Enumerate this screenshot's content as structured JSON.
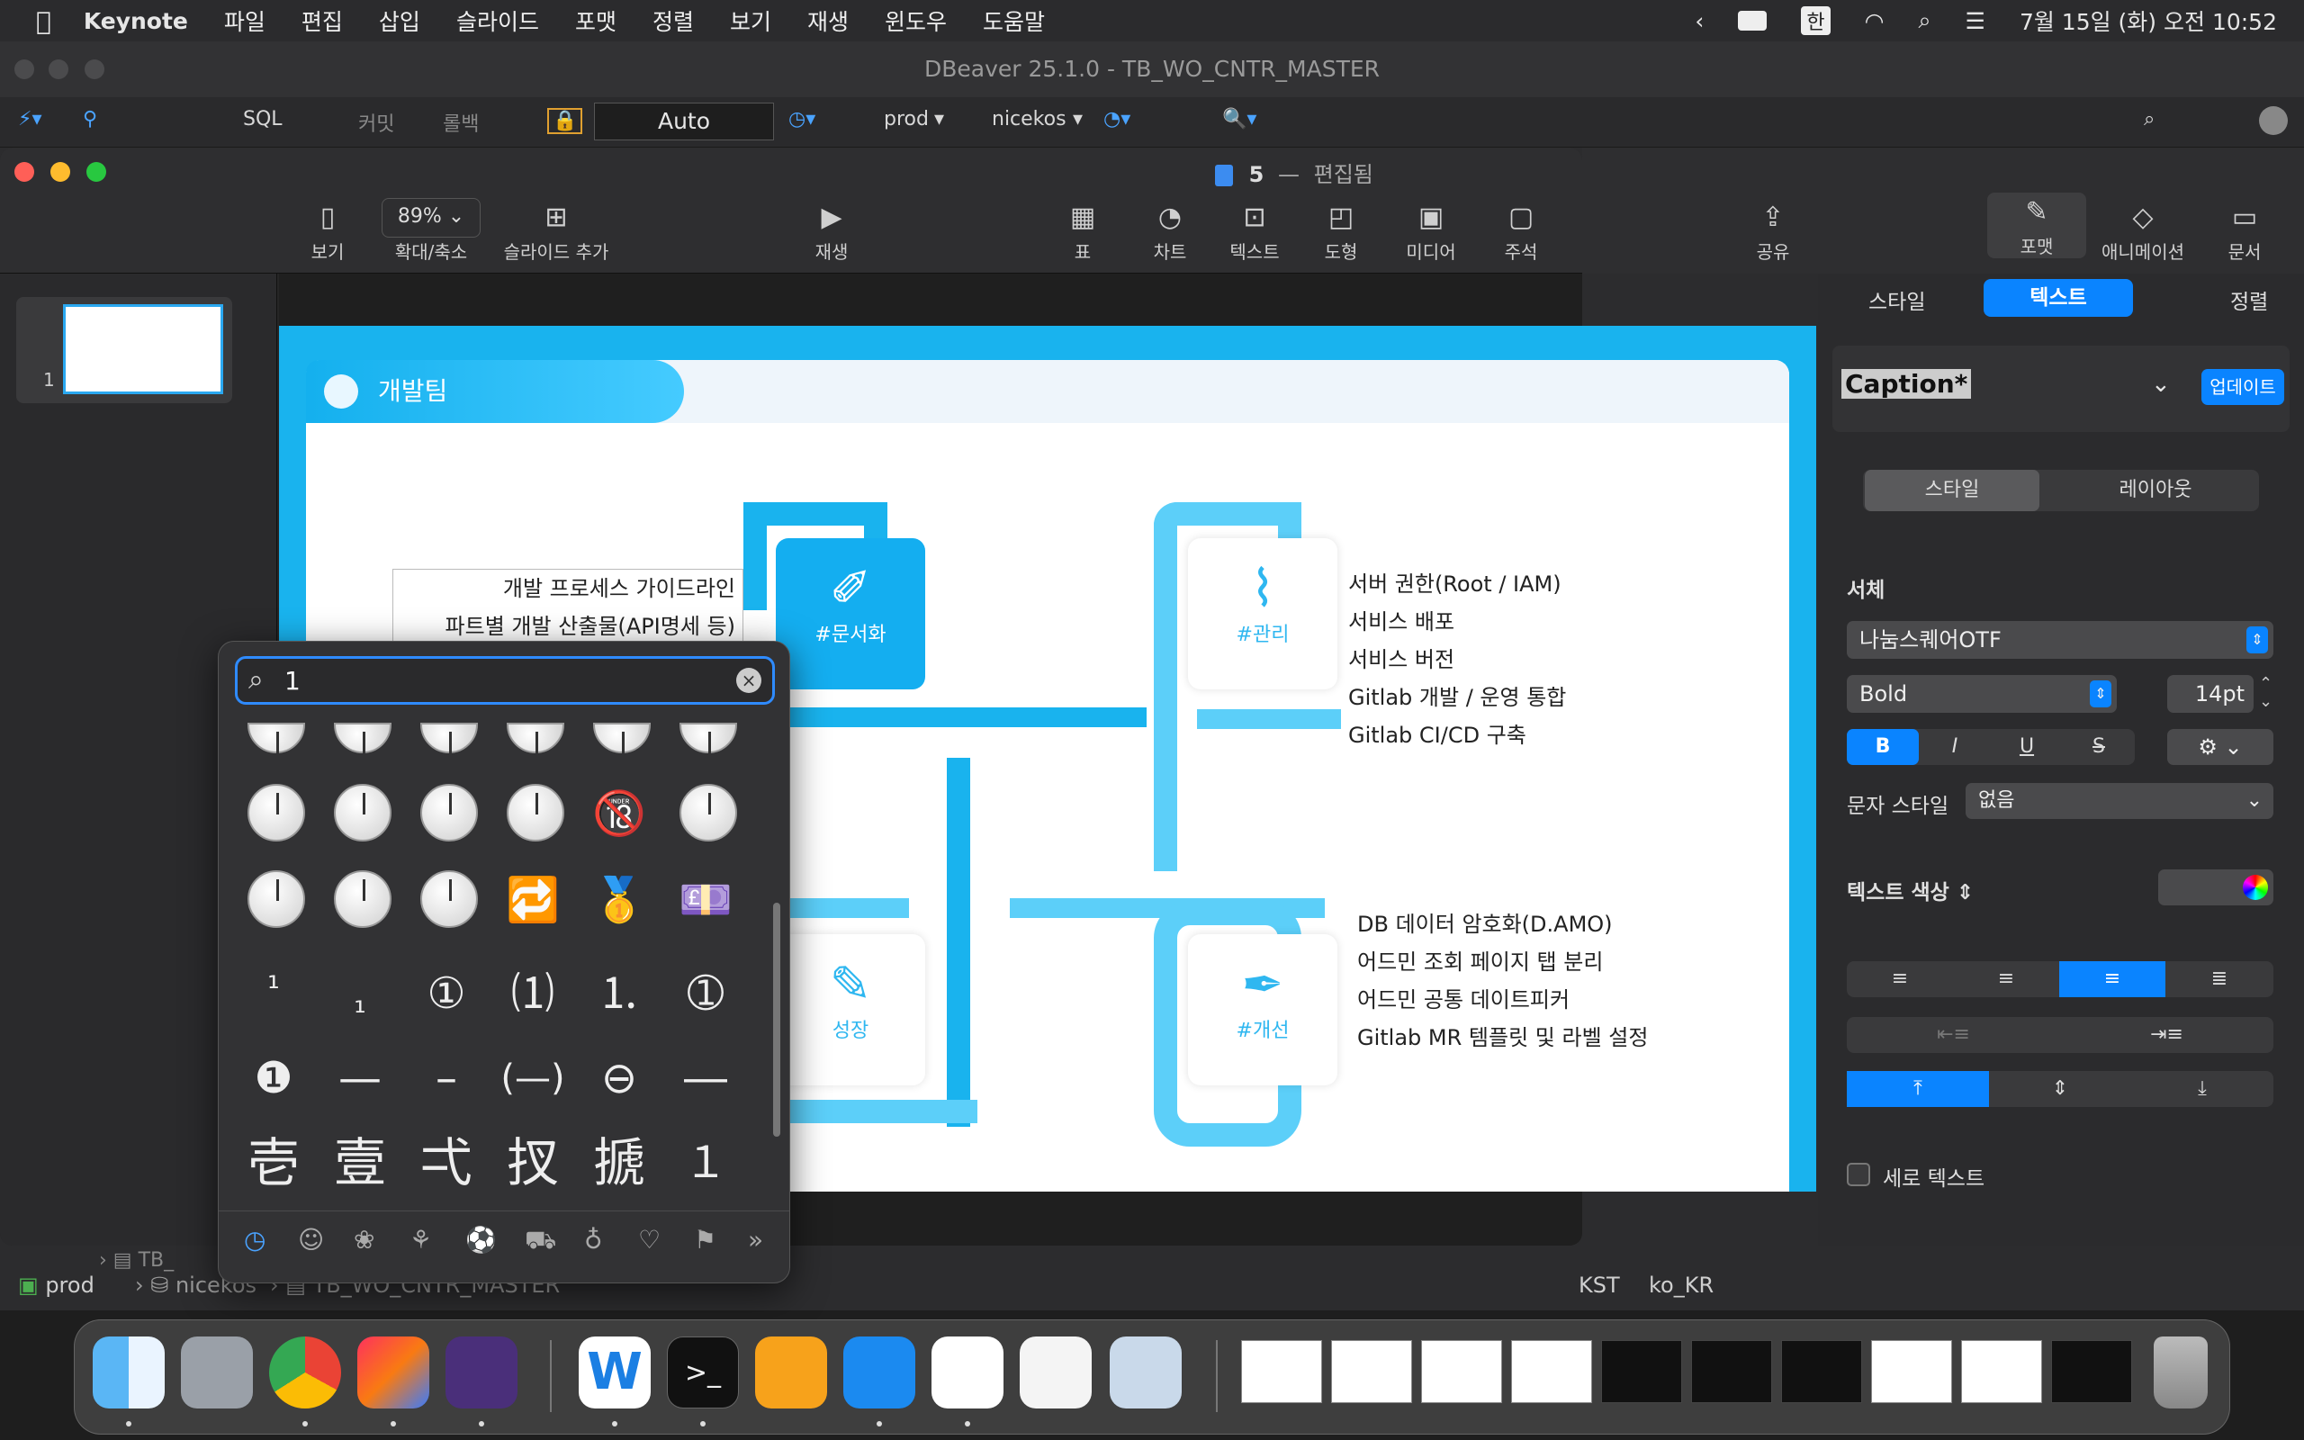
{
  "menubar": {
    "app": "Keynote",
    "items": [
      "파일",
      "편집",
      "삽입",
      "슬라이드",
      "포맷",
      "정렬",
      "보기",
      "재생",
      "윈도우",
      "도움말"
    ],
    "ime": "한",
    "datetime": "7월 15일 (화) 오전 10:52"
  },
  "dbeaver": {
    "title": "DBeaver 25.1.0 - TB_WO_CNTR_MASTER",
    "toolbar": {
      "sql": "SQL",
      "commit": "커밋",
      "rollback": "롤백",
      "mode": "Auto",
      "connection": "prod",
      "schema": "nicekos"
    },
    "status": {
      "conn": "prod",
      "schema": "nicekos",
      "table": "TB_WO_CNTR_MASTER",
      "tz": "KST",
      "locale": "ko_KR",
      "tree_item": "TB_"
    }
  },
  "keynote": {
    "title": "5 — 편집됨",
    "doc_name": "5",
    "doc_state": "편집됨",
    "zoom": "89%",
    "toolbar": {
      "view": "보기",
      "zoom_label": "확대/축소",
      "add_slide": "슬라이드 추가",
      "play": "재생",
      "table": "표",
      "chart": "차트",
      "text": "텍스트",
      "shape": "도형",
      "media": "미디어",
      "comment": "주석",
      "share": "공유",
      "format": "포맷",
      "animate": "애니메이션",
      "document": "문서"
    },
    "slide_number": "1"
  },
  "slide": {
    "header": "개발팀",
    "cards": {
      "doc": "#문서화",
      "manage": "#관리",
      "grow": "성장",
      "improve": "#개선"
    },
    "doc_lines": [
      "개발 프로세스 가이드라인",
      "파트별 개발 산출물(API명세 등)"
    ],
    "manage_lines": [
      "서버 권한(Root / IAM)",
      "서비스 배포",
      "서비스 버전",
      "Gitlab 개발 / 운영 통합",
      "Gitlab CI/CD 구축"
    ],
    "improve_lines": [
      "DB 데이터 암호화(D.AMO)",
      "어드민 조회 페이지 탭 분리",
      "어드민 공통 데이트피커",
      "Gitlab MR 템플릿 및 라벨 설정"
    ]
  },
  "inspector": {
    "tabs": [
      "스타일",
      "텍스트",
      "정렬"
    ],
    "active_tab": "텍스트",
    "paragraph_style": "Caption*",
    "update_btn": "업데이트",
    "subtabs": [
      "스타일",
      "레이아웃"
    ],
    "font_label": "서체",
    "font": "나눔스퀘어OTF",
    "weight": "Bold",
    "size": "14pt",
    "char_style_label": "문자 스타일",
    "char_style": "없음",
    "text_color_label": "텍스트 색상",
    "vertical_text": "세로 텍스트",
    "bold": "B",
    "italic": "I",
    "underline": "U",
    "strike": "S"
  },
  "picker": {
    "query": "1",
    "rows": [
      [
        "clock",
        "clock",
        "clock",
        "clock",
        "🔞",
        "clock"
      ],
      [
        "clock",
        "clock",
        "clock",
        "🔁",
        "🥇",
        "💷"
      ],
      [
        "¹",
        "₁",
        "①",
        "⑴",
        "⒈",
        "➀"
      ],
      [
        "❶",
        "—",
        "–",
        "(—)",
        "⊖",
        "―"
      ],
      [
        "壱",
        "壹",
        "弌",
        "扠",
        "搋",
        "１"
      ]
    ],
    "categories": [
      "recent-icon",
      "smiley-icon",
      "animal-icon",
      "food-icon",
      "ball-icon",
      "car-icon",
      "bulb-icon",
      "heart-icon",
      "flag-icon",
      "more-icon"
    ]
  },
  "colors": {
    "accent": "#2f8bff",
    "slide_blue": "#19b3ee",
    "light_blue": "#5ccff9"
  }
}
